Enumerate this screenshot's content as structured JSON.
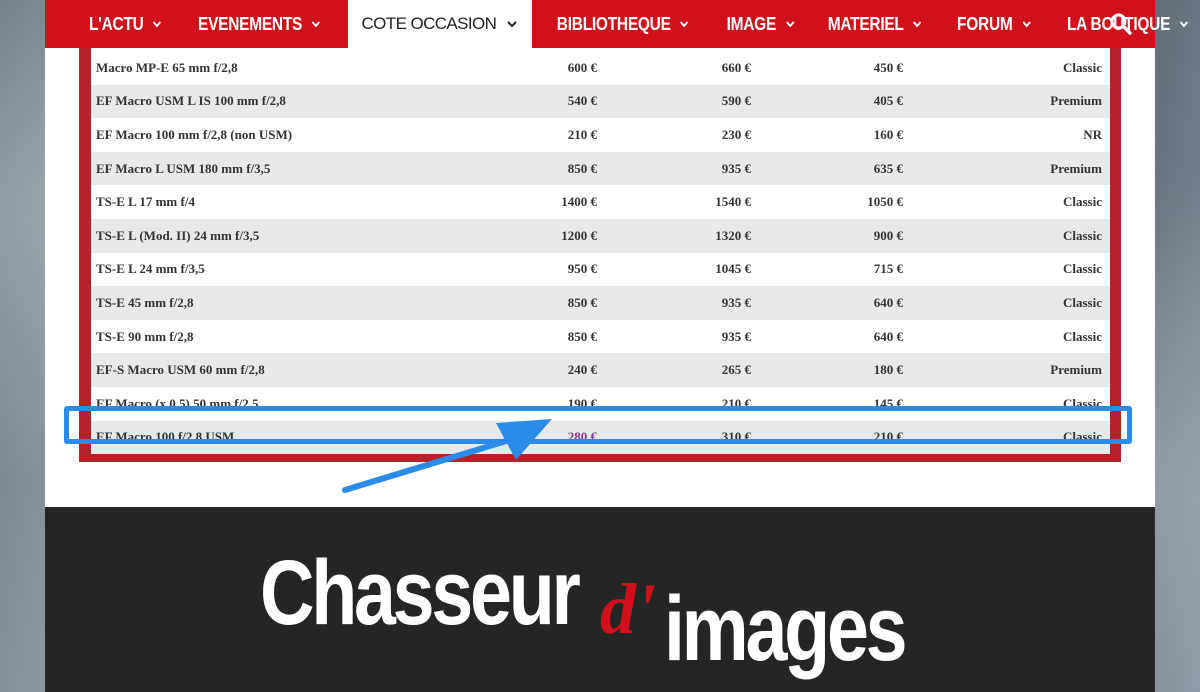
{
  "nav": {
    "items": [
      {
        "label": "L'ACTU"
      },
      {
        "label": "EVENEMENTS"
      },
      {
        "label": "COTE OCCASION"
      },
      {
        "label": "BIBLIOTHEQUE"
      },
      {
        "label": "IMAGE"
      },
      {
        "label": "MATERIEL"
      },
      {
        "label": "FORUM"
      },
      {
        "label": "LA BOUTIQUE"
      }
    ],
    "active_index": 2,
    "search_icon": "search-icon"
  },
  "table": {
    "rows": [
      {
        "name": "Macro MP-E 65 mm f/2,8",
        "p1": "600 €",
        "p2": "660 €",
        "p3": "450 €",
        "type": "Classic"
      },
      {
        "name": "EF Macro USM L IS 100 mm f/2,8",
        "p1": "540 €",
        "p2": "590 €",
        "p3": "405 €",
        "type": "Premium"
      },
      {
        "name": "EF Macro 100 mm f/2,8 (non USM)",
        "p1": "210 €",
        "p2": "230 €",
        "p3": "160 €",
        "type": "NR"
      },
      {
        "name": "EF Macro L USM 180 mm f/3,5",
        "p1": "850 €",
        "p2": "935 €",
        "p3": "635 €",
        "type": "Premium"
      },
      {
        "name": "TS-E L 17 mm f/4",
        "p1": "1400 €",
        "p2": "1540 €",
        "p3": "1050 €",
        "type": "Classic"
      },
      {
        "name": "TS-E L (Mod. II) 24 mm f/3,5",
        "p1": "1200 €",
        "p2": "1320 €",
        "p3": "900 €",
        "type": "Classic"
      },
      {
        "name": "TS-E L 24 mm f/3,5",
        "p1": "950 €",
        "p2": "1045 €",
        "p3": "715 €",
        "type": "Classic"
      },
      {
        "name": "TS-E 45 mm f/2,8",
        "p1": "850 €",
        "p2": "935 €",
        "p3": "640 €",
        "type": "Classic"
      },
      {
        "name": "TS-E 90 mm f/2,8",
        "p1": "850 €",
        "p2": "935 €",
        "p3": "640 €",
        "type": "Classic"
      },
      {
        "name": "EF-S Macro USM 60 mm f/2,8",
        "p1": "240 €",
        "p2": "265 €",
        "p3": "180 €",
        "type": "Premium"
      },
      {
        "name": "EF Macro (x 0,5) 50 mm f/2,5",
        "p1": "190 €",
        "p2": "210 €",
        "p3": "145 €",
        "type": "Classic"
      },
      {
        "name": "EF Macro 100 f/2,8 USM",
        "p1": "280 €",
        "p2": "310 €",
        "p3": "210 €",
        "type": "Classic"
      }
    ],
    "highlighted_row_index": 11
  },
  "footer": {
    "logo_main": "Chasseur",
    "logo_accent": "d'",
    "logo_end": "images"
  },
  "colors": {
    "brand_red": "#d0111b",
    "table_frame": "#b8202c",
    "highlight_blue": "#2a8be8",
    "footer_bg": "#252525"
  }
}
